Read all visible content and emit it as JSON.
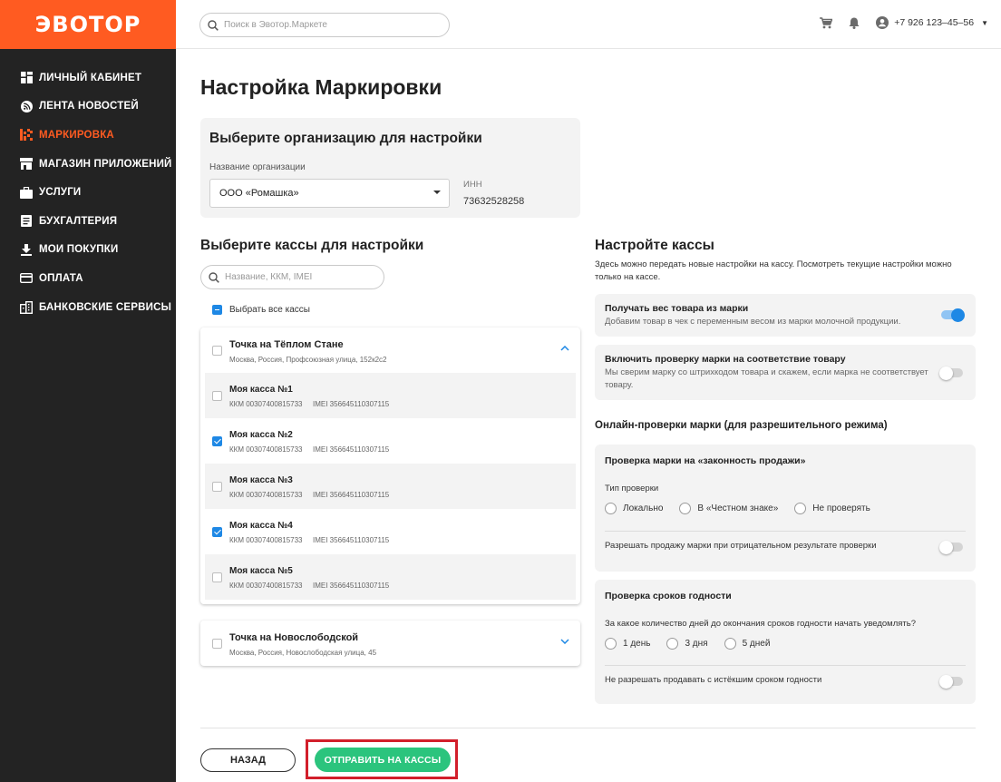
{
  "logo": "ЭВОТОР",
  "search": {
    "placeholder": "Поиск в Эвотор.Маркете"
  },
  "user": {
    "phone": "+7 926 123–45–56"
  },
  "colors": {
    "brand": "#ff5b21",
    "sidebar": "#232323",
    "accent": "#1e88e5",
    "success": "#2bc47d",
    "highlight": "#d21f2b"
  },
  "sidebar": {
    "items": [
      {
        "label": "ЛИЧНЫЙ КАБИНЕТ",
        "icon": "dashboard-icon",
        "active": false
      },
      {
        "label": "ЛЕНТА НОВОСТЕЙ",
        "icon": "news-icon",
        "active": false
      },
      {
        "label": "МАРКИРОВКА",
        "icon": "marking-icon",
        "active": true
      },
      {
        "label": "МАГАЗИН ПРИЛОЖЕНИЙ",
        "icon": "store-icon",
        "active": false
      },
      {
        "label": "УСЛУГИ",
        "icon": "briefcase-icon",
        "active": false
      },
      {
        "label": "БУХГАЛТЕРИЯ",
        "icon": "accounting-icon",
        "active": false
      },
      {
        "label": "МОИ ПОКУПКИ",
        "icon": "download-icon",
        "active": false
      },
      {
        "label": "ОПЛАТА",
        "icon": "card-icon",
        "active": false
      },
      {
        "label": "БАНКОВСКИЕ СЕРВИСЫ",
        "icon": "bank-icon",
        "active": false
      }
    ]
  },
  "page": {
    "title": "Настройка Маркировки"
  },
  "org": {
    "heading": "Выберите организацию для настройки",
    "name_label": "Название организации",
    "selected": "ООО «Ромашка»",
    "inn_label": "ИНН",
    "inn_value": "73632528258"
  },
  "kassas": {
    "heading": "Выберите кассы для настройки",
    "search_placeholder": "Название, ККМ, IMEI",
    "select_all": "Выбрать все кассы",
    "points": [
      {
        "name": "Точка на Тёплом Стане",
        "address": "Москва, Россия, Профсоюзная улица, 152к2с2",
        "expanded": true,
        "items": [
          {
            "name": "Моя касса №1",
            "kkm": "ККМ 00307400815733",
            "imei": "IMEI 356645110307115",
            "checked": false
          },
          {
            "name": "Моя касса №2",
            "kkm": "ККМ 00307400815733",
            "imei": "IMEI 356645110307115",
            "checked": true
          },
          {
            "name": "Моя касса №3",
            "kkm": "ККМ 00307400815733",
            "imei": "IMEI 356645110307115",
            "checked": false
          },
          {
            "name": "Моя касса №4",
            "kkm": "ККМ 00307400815733",
            "imei": "IMEI 356645110307115",
            "checked": true
          },
          {
            "name": "Моя касса №5",
            "kkm": "ККМ 00307400815733",
            "imei": "IMEI 356645110307115",
            "checked": false
          }
        ]
      },
      {
        "name": "Точка на Новослободской",
        "address": "Москва, Россия, Новослободская улица, 45",
        "expanded": false,
        "items": []
      }
    ]
  },
  "settings": {
    "heading": "Настройте кассы",
    "description": "Здесь можно передать новые настройки на кассу. Посмотреть текущие настройки можно только на кассе.",
    "weight": {
      "title": "Получать вес товара из марки",
      "subtitle": "Добавим товар в чек с переменным весом из марки молочной продукции.",
      "enabled": true
    },
    "verify": {
      "title": "Включить проверку марки на соответствие товару",
      "subtitle": "Мы сверим марку со штрихкодом товара и скажем, если марка не соответствует товару.",
      "enabled": false
    },
    "online_heading": "Онлайн-проверки марки (для разрешительного режима)",
    "legality": {
      "title": "Проверка марки на «законность продажи»",
      "type_label": "Тип проверки",
      "options": [
        "Локально",
        "В «Честном знаке»",
        "Не проверять"
      ],
      "allow_label": "Разрешать продажу марки при отрицательном результате проверки",
      "allow_enabled": false
    },
    "expiry": {
      "title": "Проверка сроков годности",
      "question": "За какое количество дней до окончания сроков годности начать уведомлять?",
      "options": [
        "1 день",
        "3 дня",
        "5 дней"
      ],
      "forbid_label": "Не разрешать продавать с истёкшим сроком годности",
      "forbid_enabled": false
    }
  },
  "actions": {
    "back": "НАЗАД",
    "send": "ОТПРАВИТЬ НА КАССЫ"
  }
}
